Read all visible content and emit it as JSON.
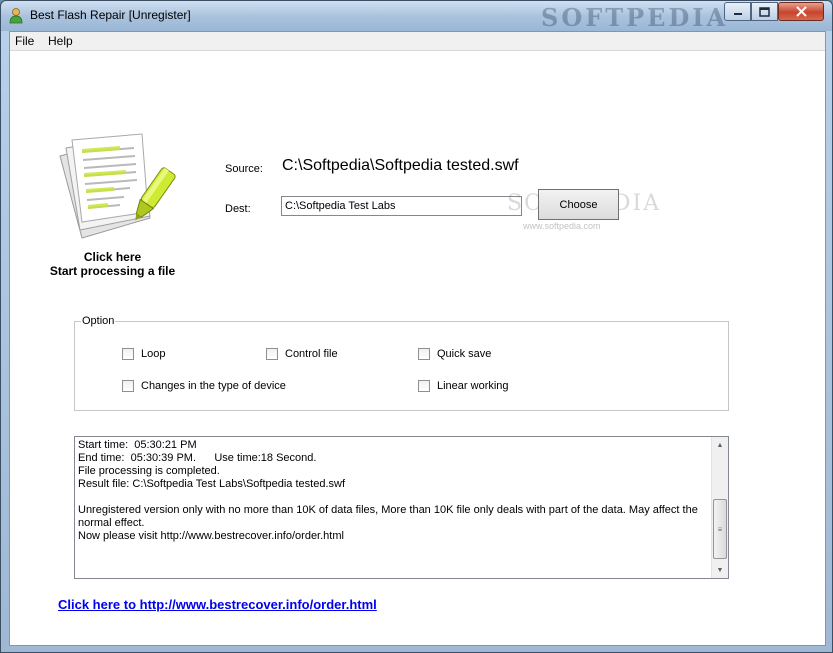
{
  "window": {
    "title": "Best Flash Repair [Unregister]",
    "watermark": "SOFTPEDIA"
  },
  "menu": {
    "file": "File",
    "help": "Help"
  },
  "main": {
    "click_here": "Click here",
    "start_processing": "Start processing a file",
    "source_label": "Source:",
    "source_value": "C:\\Softpedia\\Softpedia tested.swf",
    "dest_label": "Dest:",
    "dest_value": "C:\\Softpedia Test Labs",
    "choose_label": "Choose",
    "watermark_url": "www.softpedia.com"
  },
  "options": {
    "title": "Option",
    "loop": "Loop",
    "control_file": "Control file",
    "quick_save": "Quick save",
    "changes_device": "Changes in the type of device",
    "linear_working": "Linear working"
  },
  "log": {
    "lines": [
      "Start time:  05:30:21 PM",
      "End time:  05:30:39 PM.      Use time:18 Second.",
      "File processing is completed.",
      "Result file: C:\\Softpedia Test Labs\\Softpedia tested.swf",
      "",
      "Unregistered version only with no more than 10K of data files, More than 10K file only deals with part of the data. May affect the normal effect.",
      "Now please visit http://www.bestrecover.info/order.html"
    ]
  },
  "footer": {
    "order_link": "Click here to http://www.bestrecover.info/order.html"
  }
}
